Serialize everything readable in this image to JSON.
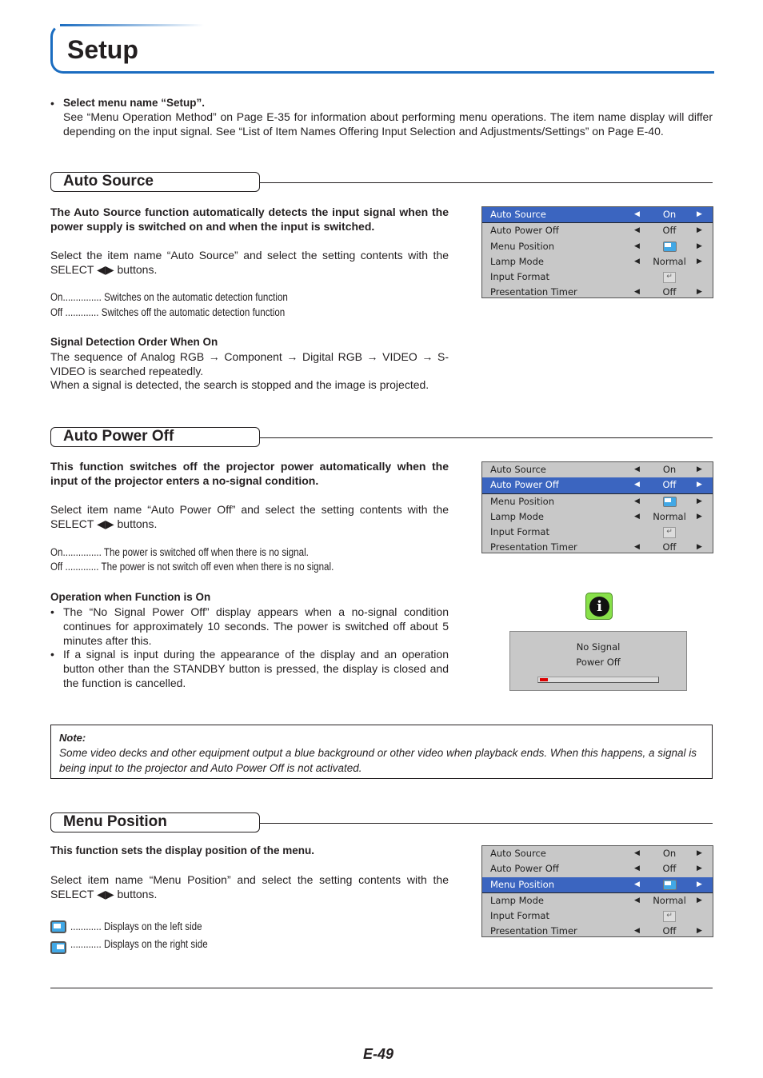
{
  "header": {
    "title": "Setup"
  },
  "intro": {
    "bullet": "•",
    "heading": "Select menu name “Setup”.",
    "body": "See “Menu Operation Method” on Page E-35 for information about performing menu operations. The item name display will differ depending on the input signal. See “List of Item Names Offering Input Selection and Adjustments/Settings” on Page E-40."
  },
  "osd_common": {
    "rows": [
      {
        "label": "Auto Source",
        "value": "On",
        "arrows": true
      },
      {
        "label": "Auto Power Off",
        "value": "Off",
        "arrows": true
      },
      {
        "label": "Menu Position",
        "value": "menu-position-icon",
        "arrows": true
      },
      {
        "label": "Lamp Mode",
        "value": "Normal",
        "arrows": true
      },
      {
        "label": "Input Format",
        "value": "enter-icon",
        "arrows": false
      },
      {
        "label": "Presentation Timer",
        "value": "Off",
        "arrows": true
      }
    ],
    "left_arrow": "◀",
    "right_arrow": "▶",
    "enter_glyph": "↵",
    "selected_color": "#3b65c0",
    "background_color": "#c8c8c8"
  },
  "sections": {
    "auto_source": {
      "title": "Auto Source",
      "lead": "The Auto Source function automatically detects the input signal when the power supply is switched on and when the input is switched.",
      "instruction": "Select the item name “Auto Source” and select the setting contents with the SELECT ◀▶ buttons.",
      "options": [
        {
          "key": "On",
          "dots": "...............",
          "desc": "Switches on the automatic detection function"
        },
        {
          "key": "Off",
          "dots": ".............",
          "desc": "Switches off the automatic detection function"
        }
      ],
      "sub_heading": "Signal Detection Order When On",
      "sub_body_1": "The sequence of Analog RGB → Component → Digital RGB → VIDEO → S-VIDEO is searched repeatedly.",
      "sub_body_2": "When a signal is detected, the search is stopped and the image is projected.",
      "osd_selected": "Auto Source"
    },
    "auto_power_off": {
      "title": "Auto Power Off",
      "lead": "This function switches off the projector power automatically when the input of the projector enters a no-signal condition.",
      "instruction": "Select item name “Auto Power Off” and select the setting contents with the SELECT ◀▶ buttons.",
      "options": [
        {
          "key": "On",
          "dots": "...............",
          "desc": "The power is switched off when there is no signal."
        },
        {
          "key": "Off",
          "dots": ".............",
          "desc": "The power is not switch off even when there is no signal."
        }
      ],
      "sub_heading": "Operation when Function is On",
      "bullets": [
        "The “No Signal Power Off” display appears when a no-signal condition continues for approximately 10 seconds. The power is switched off about 5 minutes after this.",
        "If a signal is input during the appearance of the display and an operation button other than the STANDBY button is pressed, the display is closed and the function is cancelled."
      ],
      "osd_selected": "Auto Power Off",
      "no_signal_dialog": {
        "icon": "info-icon",
        "line1": "No Signal",
        "line2": "Power Off",
        "progress_fraction": 0.07
      }
    },
    "menu_position": {
      "title": "Menu Position",
      "lead": "This function sets the display position of the menu.",
      "instruction": "Select item name “Menu Position” and select the setting contents with the SELECT ◀▶ buttons.",
      "options": [
        {
          "icon": "menu-left-icon",
          "dots": "............",
          "desc": "Displays on the left side"
        },
        {
          "icon": "menu-right-icon",
          "dots": "............",
          "desc": "Displays on the right side"
        }
      ],
      "osd_selected": "Menu Position"
    }
  },
  "note": {
    "label": "Note:",
    "body": "Some video decks and other equipment output a blue background or other video when playback ends. When this happens, a signal is being input to the projector and Auto Power Off is not activated."
  },
  "footer": {
    "page_number": "E-49"
  }
}
